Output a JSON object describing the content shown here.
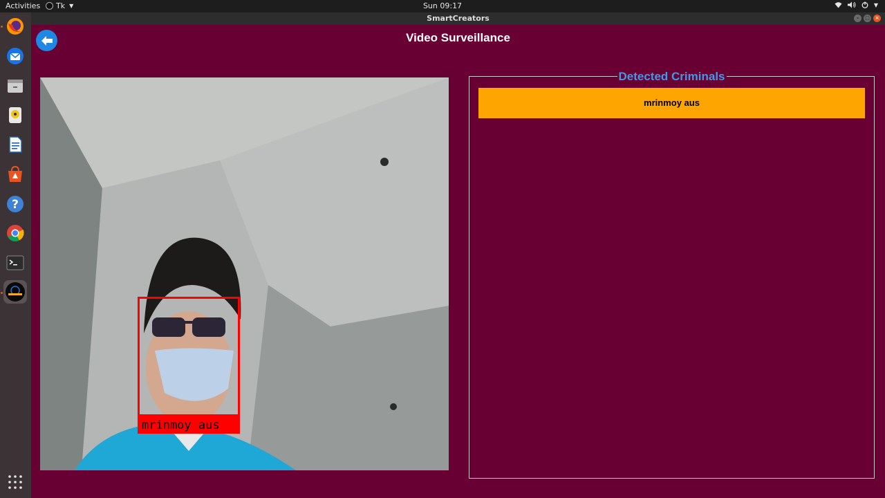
{
  "system": {
    "activities_label": "Activities",
    "app_menu_label": "Tk",
    "clock": "Sun 09:17"
  },
  "window": {
    "title": "SmartCreators"
  },
  "dock": {
    "items": [
      {
        "name": "firefox-icon"
      },
      {
        "name": "thunderbird-icon"
      },
      {
        "name": "files-icon"
      },
      {
        "name": "rhythmbox-icon"
      },
      {
        "name": "writer-icon"
      },
      {
        "name": "software-icon"
      },
      {
        "name": "help-icon"
      },
      {
        "name": "chrome-icon"
      },
      {
        "name": "terminal-icon"
      },
      {
        "name": "smartcreators-app-icon"
      }
    ],
    "show_apps_icon": "grid-icon"
  },
  "app": {
    "page_title": "Video Surveillance",
    "back_icon": "arrow-left-icon",
    "camera": {
      "detection_label": "mrinmoy aus"
    },
    "detected_panel": {
      "heading": "Detected Criminals",
      "items": [
        "mrinmoy aus"
      ]
    }
  },
  "colors": {
    "background": "#690034",
    "accent": "#1e88e5",
    "heading": "#3d9be9",
    "highlight": "#ffa500",
    "detection_box": "#ff0000"
  }
}
